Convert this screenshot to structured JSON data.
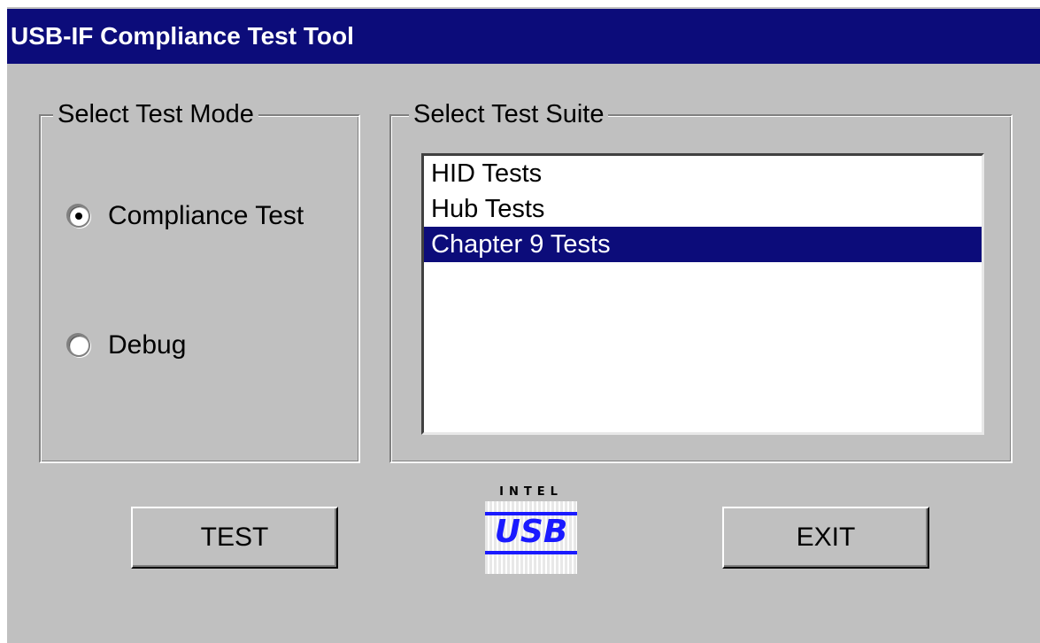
{
  "window": {
    "title": "USB-IF Compliance Test Tool"
  },
  "test_mode": {
    "label": "Select Test Mode",
    "options": [
      {
        "label": "Compliance Test",
        "selected": true
      },
      {
        "label": "Debug",
        "selected": false
      }
    ]
  },
  "test_suite": {
    "label": "Select Test Suite",
    "items": [
      {
        "label": "HID Tests",
        "selected": false
      },
      {
        "label": "Hub Tests",
        "selected": false
      },
      {
        "label": "Chapter 9 Tests",
        "selected": true
      }
    ]
  },
  "buttons": {
    "test_label": "TEST",
    "exit_label": "EXIT"
  },
  "logo": {
    "top_text": "INTEL",
    "main_text": "USB"
  },
  "colors": {
    "titlebar": "#0c0c7a",
    "selection": "#0c0c7a",
    "face": "#c0c0c0",
    "logo_blue": "#1a1aff"
  }
}
